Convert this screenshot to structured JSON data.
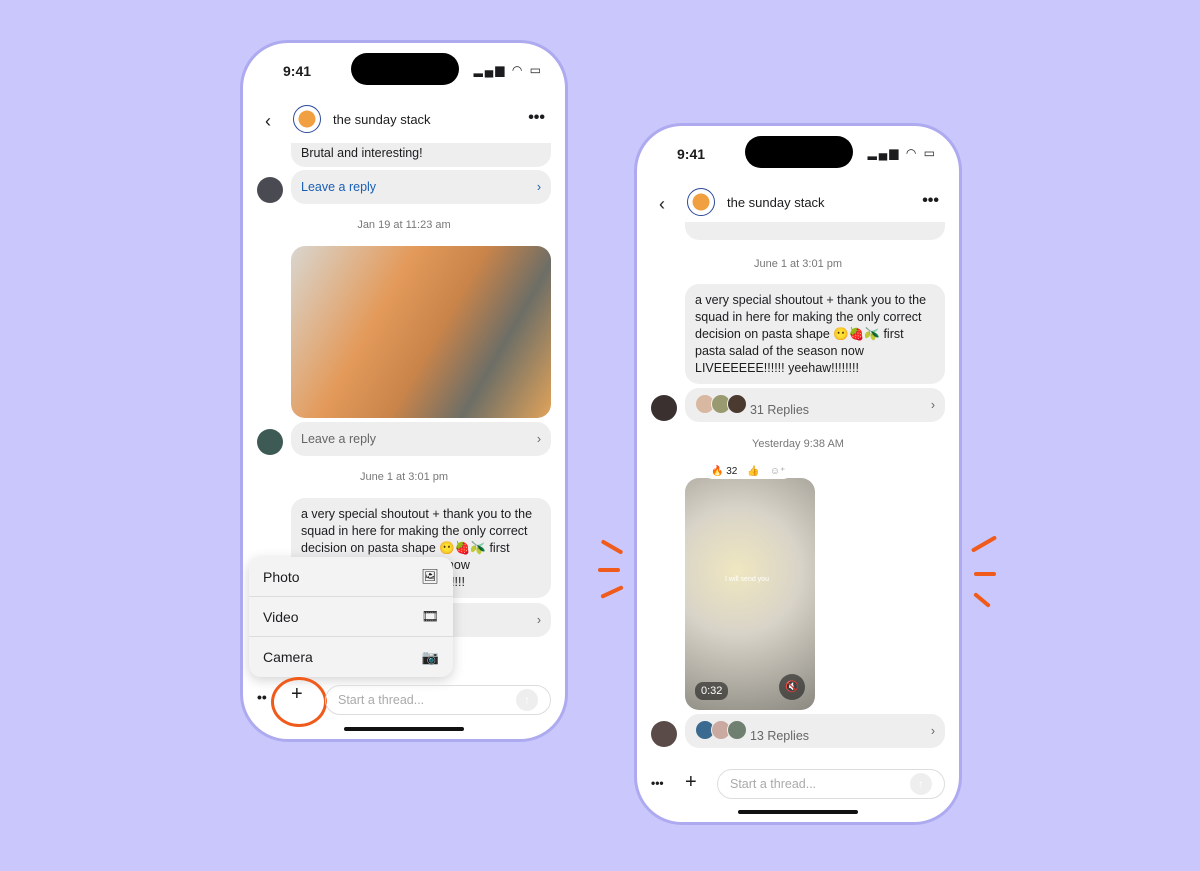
{
  "status": {
    "time": "9:41",
    "signal": "▂▄▆",
    "wifi": "wifi",
    "battery": "battery"
  },
  "header": {
    "back": "‹",
    "title": "the sunday stack",
    "more": "•••"
  },
  "left": {
    "msg1": "Brutal and interesting!",
    "reply1": "Leave a reply",
    "date1": "Jan 19 at 11:23 am",
    "reply2": "Leave a reply",
    "date2": "June 1 at 3:01 pm",
    "msg2": "a very special shoutout + thank you to the squad in here for making the only correct decision on pasta shape 😶🍓🫒 first pasta salad of the season now LIVEEEEEE!!!!!! yeehaw!!!!!!!!",
    "menu": [
      {
        "label": "Photo",
        "icon": "image-icon"
      },
      {
        "label": "Video",
        "icon": "film-icon"
      },
      {
        "label": "Camera",
        "icon": "camera-icon"
      }
    ],
    "input_placeholder": "Start a thread..."
  },
  "right": {
    "date1": "June 1 at 3:01 pm",
    "msg": "a very special shoutout + thank you to the squad in here for making the only correct decision on pasta shape 😶🍓🫒 first pasta salad of the season now LIVEEEEEE!!!!!! yeehaw!!!!!!!!",
    "replies1": "31 Replies",
    "date2": "Yesterday 9:38 AM",
    "reactions": [
      {
        "emoji": "🔥",
        "count": "32"
      },
      {
        "emoji": "👍",
        "count": ""
      }
    ],
    "video_time": "0:32",
    "video_caption": "I will send you",
    "replies2": "13 Replies",
    "input_placeholder": "Start a thread..."
  },
  "colors": {
    "background": "#c9c7fb",
    "accent_orange": "#f05a1a",
    "link_blue": "#1a5fb4"
  }
}
